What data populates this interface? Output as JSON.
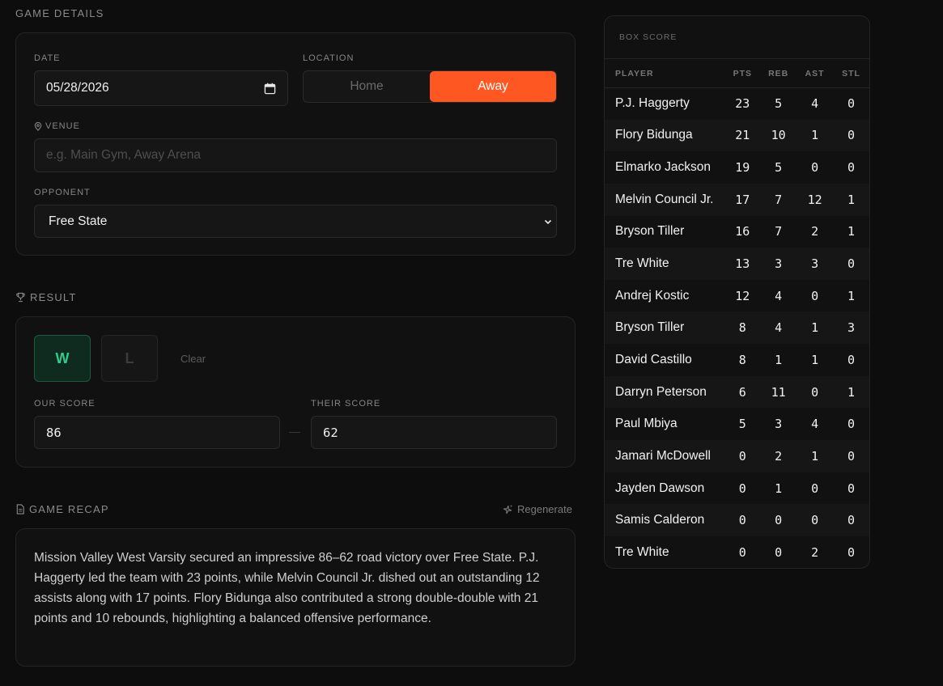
{
  "game_details": {
    "section_title": "GAME DETAILS",
    "date_label": "DATE",
    "date_value": "05/28/2026",
    "location_label": "LOCATION",
    "location_options": [
      "Home",
      "Away"
    ],
    "location_selected": "Away",
    "venue_label": "VENUE",
    "venue_placeholder": "e.g. Main Gym, Away Arena",
    "opponent_label": "OPPONENT",
    "opponent_value": "Free State"
  },
  "result": {
    "section_title": "RESULT",
    "win_label": "W",
    "loss_label": "L",
    "selected": "W",
    "clear_label": "Clear",
    "our_score_label": "OUR SCORE",
    "our_score": "86",
    "separator": "—",
    "their_score_label": "THEIR SCORE",
    "their_score": "62"
  },
  "recap": {
    "section_title": "GAME RECAP",
    "regenerate_label": "Regenerate",
    "text": "Mission Valley West Varsity secured an impressive 86–62 road victory over Free State. P.J. Haggerty led the team with 23 points, while Melvin Council Jr. dished out an outstanding 12 assists along with 17 points. Flory Bidunga also contributed a strong double-double with 21 points and 10 rebounds, highlighting a balanced offensive performance."
  },
  "box_score": {
    "title": "BOX SCORE",
    "columns": [
      "PLAYER",
      "PTS",
      "REB",
      "AST",
      "STL"
    ],
    "rows": [
      {
        "player": "P.J. Haggerty",
        "pts": "23",
        "reb": "5",
        "ast": "4",
        "stl": "0"
      },
      {
        "player": "Flory Bidunga",
        "pts": "21",
        "reb": "10",
        "ast": "1",
        "stl": "0"
      },
      {
        "player": "Elmarko Jackson",
        "pts": "19",
        "reb": "5",
        "ast": "0",
        "stl": "0"
      },
      {
        "player": "Melvin Council Jr.",
        "pts": "17",
        "reb": "7",
        "ast": "12",
        "stl": "1"
      },
      {
        "player": "Bryson Tiller",
        "pts": "16",
        "reb": "7",
        "ast": "2",
        "stl": "1"
      },
      {
        "player": "Tre White",
        "pts": "13",
        "reb": "3",
        "ast": "3",
        "stl": "0"
      },
      {
        "player": "Andrej Kostic",
        "pts": "12",
        "reb": "4",
        "ast": "0",
        "stl": "1"
      },
      {
        "player": "Bryson Tiller",
        "pts": "8",
        "reb": "4",
        "ast": "1",
        "stl": "3"
      },
      {
        "player": "David Castillo",
        "pts": "8",
        "reb": "1",
        "ast": "1",
        "stl": "0"
      },
      {
        "player": "Darryn Peterson",
        "pts": "6",
        "reb": "11",
        "ast": "0",
        "stl": "1"
      },
      {
        "player": "Paul Mbiya",
        "pts": "5",
        "reb": "3",
        "ast": "4",
        "stl": "0"
      },
      {
        "player": "Jamari McDowell",
        "pts": "0",
        "reb": "2",
        "ast": "1",
        "stl": "0"
      },
      {
        "player": "Jayden Dawson",
        "pts": "0",
        "reb": "1",
        "ast": "0",
        "stl": "0"
      },
      {
        "player": "Samis Calderon",
        "pts": "0",
        "reb": "0",
        "ast": "0",
        "stl": "0"
      },
      {
        "player": "Tre White",
        "pts": "0",
        "reb": "0",
        "ast": "2",
        "stl": "0"
      }
    ]
  },
  "icons": {
    "venue": "map-pin-icon",
    "result": "trophy-icon",
    "recap": "document-icon",
    "regenerate": "sparkle-icon",
    "calendar": "calendar-icon",
    "opponent_select": "chevron-down-icon"
  },
  "colors": {
    "accent": "#ff5722",
    "win": "#34c98a",
    "background": "#0d0d0d",
    "card": "#111111"
  }
}
